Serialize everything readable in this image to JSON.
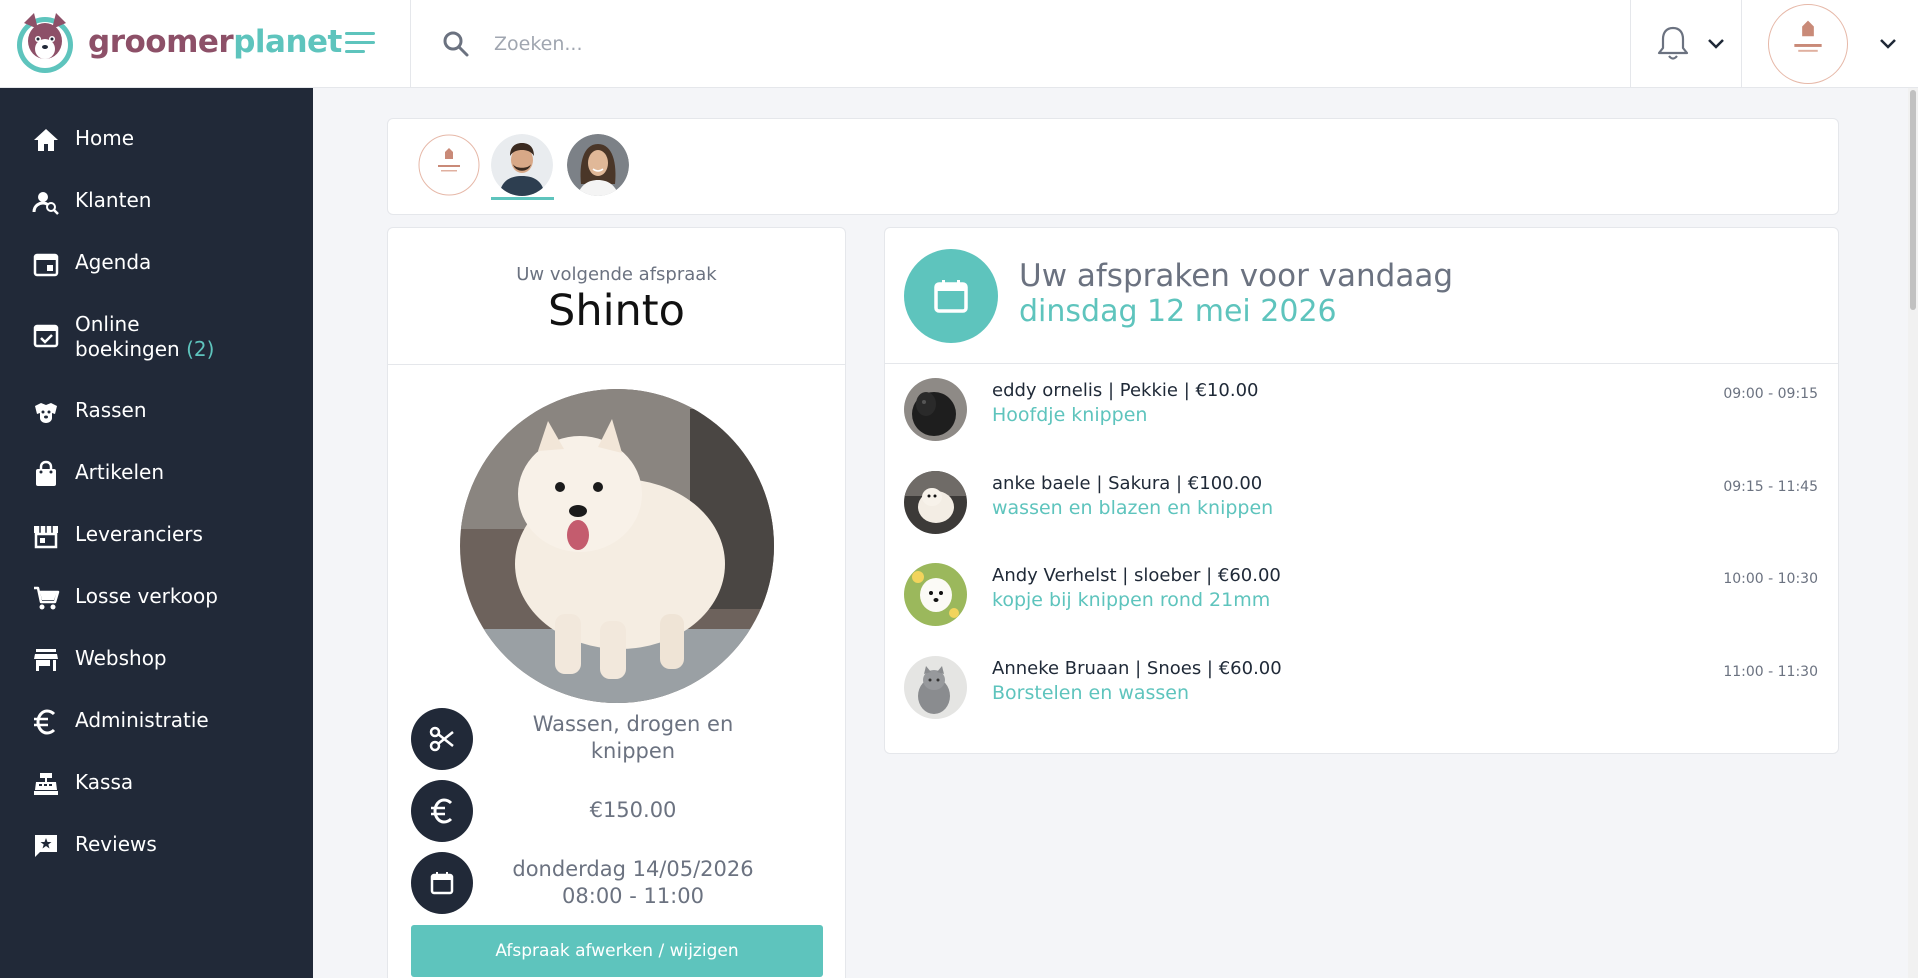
{
  "header": {
    "brand_part1": "groomer",
    "brand_part2": "planet",
    "search_placeholder": "Zoeken..."
  },
  "sidebar": {
    "items": [
      {
        "label": "Home",
        "icon": "home-icon"
      },
      {
        "label": "Klanten",
        "icon": "customers-icon"
      },
      {
        "label": "Agenda",
        "icon": "calendar-icon"
      },
      {
        "label_line1": "Online",
        "label_line2": "boekingen",
        "count": "(2)",
        "icon": "calendar-check-icon"
      },
      {
        "label": "Rassen",
        "icon": "dog-face-icon"
      },
      {
        "label": "Artikelen",
        "icon": "shopping-bag-icon"
      },
      {
        "label": "Leveranciers",
        "icon": "storefront-icon"
      },
      {
        "label": "Losse verkoop",
        "icon": "cart-icon"
      },
      {
        "label": "Webshop",
        "icon": "store-icon"
      },
      {
        "label": "Administratie",
        "icon": "euro-icon"
      },
      {
        "label": "Kassa",
        "icon": "cash-register-icon"
      },
      {
        "label": "Reviews",
        "icon": "review-star-icon"
      }
    ]
  },
  "next_appointment": {
    "subtitle": "Uw volgende afspraak",
    "pet_name": "Shinto",
    "service_line1": "Wassen, drogen en",
    "service_line2": "knippen",
    "price": "€150.00",
    "date": "donderdag 14/05/2026",
    "time": "08:00 - 11:00",
    "button_label": "Afspraak afwerken / wijzigen"
  },
  "today": {
    "title": "Uw afspraken voor vandaag",
    "date": "dinsdag 12 mei 2026",
    "appointments": [
      {
        "line1": "eddy ornelis | Pekkie | €10.00",
        "service": "Hoofdje knippen",
        "time": "09:00 - 09:15"
      },
      {
        "line1": "anke baele | Sakura | €100.00",
        "service": "wassen en blazen en knippen",
        "time": "09:15 - 11:45"
      },
      {
        "line1": "Andy Verhelst | sloeber | €60.00",
        "service": "kopje bij knippen rond 21mm",
        "time": "10:00 - 10:30"
      },
      {
        "line1": "Anneke Bruaan | Snoes | €60.00",
        "service": "Borstelen en wassen",
        "time": "11:00 - 11:30"
      }
    ]
  },
  "colors": {
    "accent": "#5ec4bd",
    "sidebar_bg": "#212938",
    "brand_purple": "#8d5068"
  }
}
